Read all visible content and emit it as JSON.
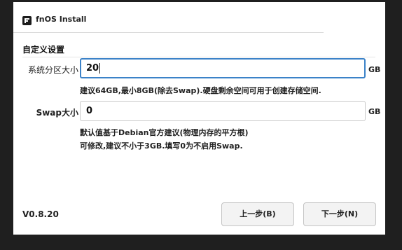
{
  "window": {
    "title": "fnOS Install"
  },
  "section": {
    "title": "自定义设置"
  },
  "system_partition": {
    "label": "系统分区大小",
    "value": "20",
    "unit": "GB",
    "hint": "建议64GB,最小8GB(除去Swap).硬盘剩余空间可用于创建存储空间."
  },
  "swap": {
    "label": "Swap大小",
    "value": "0",
    "unit": "GB",
    "hint_line1": "默认值基于Debian官方建议(物理内存的平方根)",
    "hint_line2": "可修改,建议不小于3GB.填写0为不启用Swap."
  },
  "footer": {
    "version": "V0.8.20",
    "prev_label": "上一步(B)",
    "next_label": "下一步(N)"
  },
  "colors": {
    "focus_border": "#3b82c8",
    "background": "#1f1f1f"
  }
}
